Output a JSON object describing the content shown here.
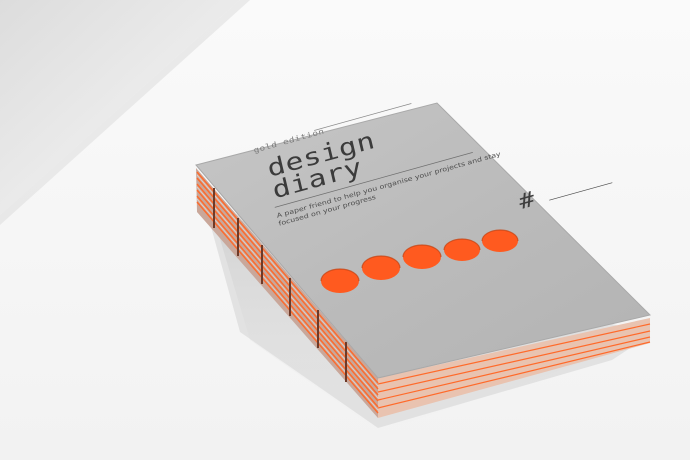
{
  "photo": {
    "subject": "notebook",
    "colors": {
      "background": "#f6f6f6",
      "cover": "#b8b8b8",
      "accent": "#ff5a1f",
      "page_edge": "#f0b89c",
      "text": "#3b3b3b"
    }
  },
  "cover": {
    "edition": "gold edition",
    "title_line_1": "design",
    "title_line_2": "diary",
    "tagline": "A paper friend to help you organise your projects and stay focused on your progress",
    "hash_label": "#",
    "cutout_holes": 5
  }
}
